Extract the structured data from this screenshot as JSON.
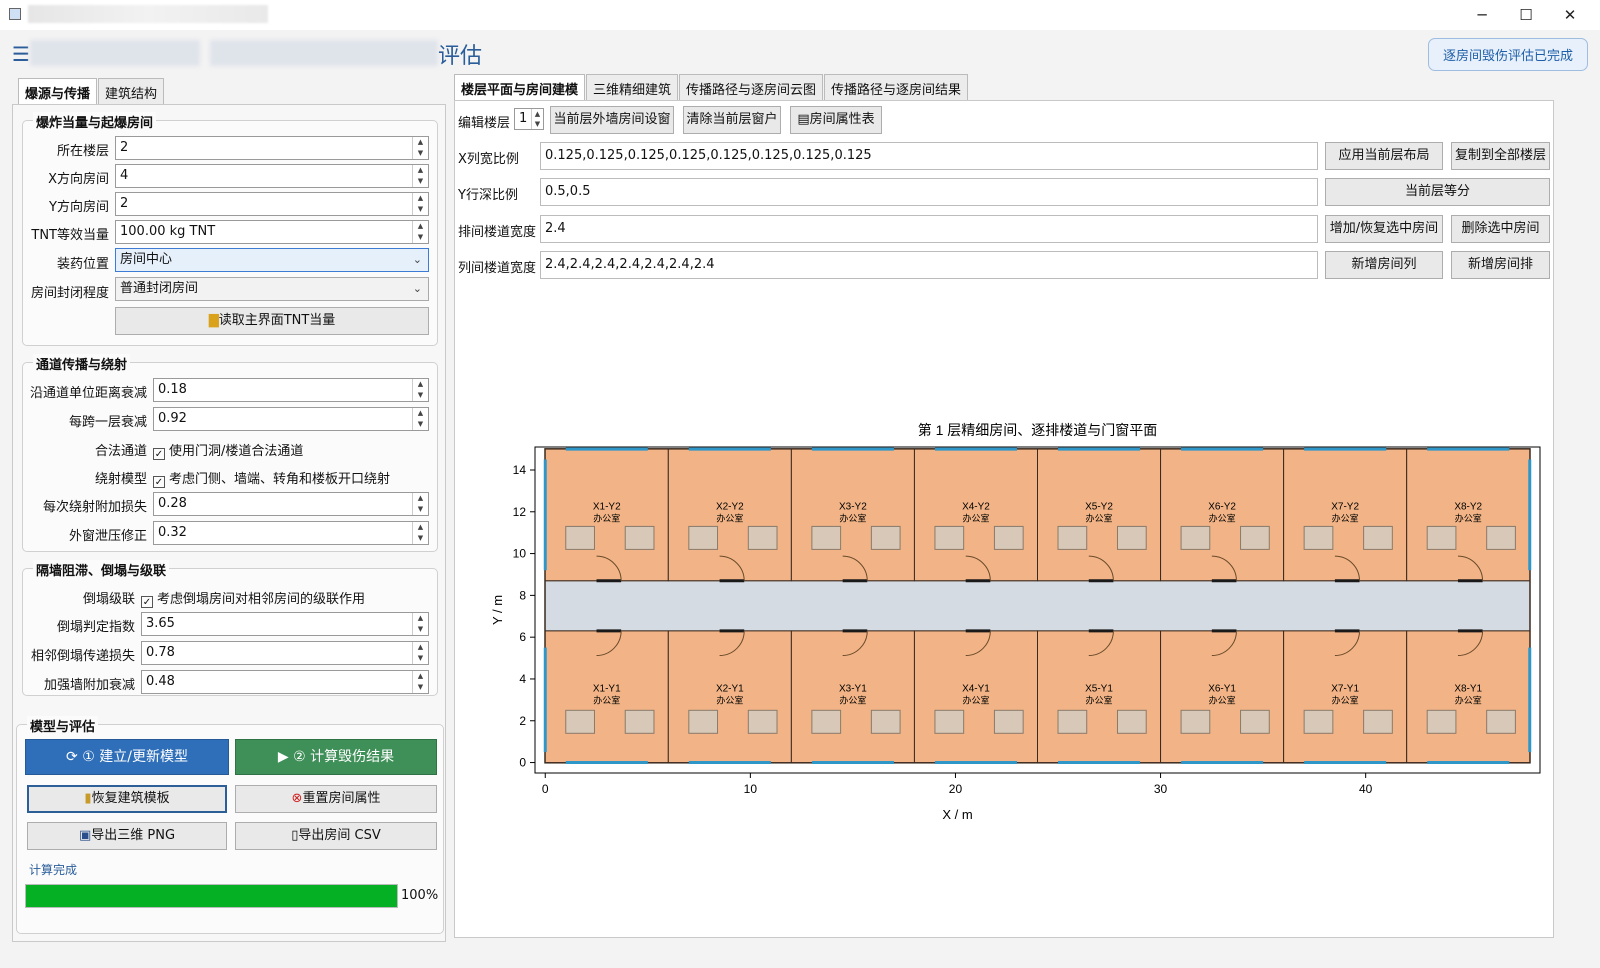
{
  "window": {
    "minimize": "─",
    "maximize": "☐",
    "close": "✕"
  },
  "header": {
    "title_fragment": "评估",
    "status": "逐房间毁伤评估已完成"
  },
  "left_tabs": [
    "爆源与传播",
    "建筑结构"
  ],
  "group1": {
    "title": "爆炸当量与起爆房间",
    "floor_label": "所在楼层",
    "floor_value": "2",
    "xroom_label": "X方向房间",
    "xroom_value": "4",
    "yroom_label": "Y方向房间",
    "yroom_value": "2",
    "tnt_label": "TNT等效当量",
    "tnt_value": "100.00 kg TNT",
    "charge_label": "装药位置",
    "charge_value": "房间中心",
    "seal_label": "房间封闭程度",
    "seal_value": "普通封闭房间",
    "read_button": "读取主界面TNT当量"
  },
  "group2": {
    "title": "通道传播与绕射",
    "atten_label": "沿通道单位距离衰减",
    "atten_value": "0.18",
    "floor_atten_label": "每跨一层衰减",
    "floor_atten_value": "0.92",
    "legal_label": "合法通道",
    "legal_text": "使用门洞/楼道合法通道",
    "diff_label": "绕射模型",
    "diff_text": "考虑门侧、墙端、转角和楼板开口绕射",
    "diff_loss_label": "每次绕射附加损失",
    "diff_loss_value": "0.28",
    "window_label": "外窗泄压修正",
    "window_value": "0.32"
  },
  "group3": {
    "title": "隔墙阻滞、倒塌与级联",
    "cascade_label": "倒塌级联",
    "cascade_text": "考虑倒塌房间对相邻房间的级联作用",
    "collapse_label": "倒塌判定指数",
    "collapse_value": "3.65",
    "adj_label": "相邻倒塌传递损失",
    "adj_value": "0.78",
    "wall_label": "加强墙附加衰减",
    "wall_value": "0.48"
  },
  "group4": {
    "title": "模型与评估",
    "build": "① 建立/更新模型",
    "compute": "② 计算毁伤结果",
    "restore": "恢复建筑模板",
    "reset": "重置房间属性",
    "export_png": "导出三维 PNG",
    "export_csv": "导出房间 CSV",
    "status": "计算完成",
    "progress": 1.0,
    "progress_text": "100%"
  },
  "right_tabs": [
    "楼层平面与房间建模",
    "三维精细建筑",
    "传播路径与逐房间云图",
    "传播路径与逐房间结果"
  ],
  "editor": {
    "floor_label": "编辑楼层",
    "floor_value": "1",
    "btn_exterior": "当前层外墙房间设窗",
    "btn_clear": "清除当前层窗户",
    "btn_props": "房间属性表",
    "x_label": "X列宽比例",
    "x_value": "0.125,0.125,0.125,0.125,0.125,0.125,0.125,0.125",
    "y_label": "Y行深比例",
    "y_value": "0.5,0.5",
    "row_corr_label": "排间楼道宽度",
    "row_corr_value": "2.4",
    "col_corr_label": "列间楼道宽度",
    "col_corr_value": "2.4,2.4,2.4,2.4,2.4,2.4,2.4",
    "apply": "应用当前层布局",
    "copy": "复制到全部楼层",
    "equal": "当前层等分",
    "add_restore": "增加/恢复选中房间",
    "delete": "删除选中房间",
    "add_col": "新增房间列",
    "add_row": "新增房间排"
  },
  "chart_data": {
    "type": "floorplan",
    "title": "第 1 层精细房间、逐排楼道与门窗平面",
    "xlabel": "X / m",
    "ylabel": "Y / m",
    "xlim": [
      -0.5,
      48.5
    ],
    "ylim": [
      -0.5,
      15.1
    ],
    "xticks": [
      0,
      10,
      20,
      30,
      40
    ],
    "yticks": [
      0,
      2,
      4,
      6,
      8,
      10,
      12,
      14
    ],
    "room_width": 6.0,
    "room_depth": 6.3,
    "corridor": [
      6.3,
      8.7
    ],
    "building": [
      0,
      48,
      0,
      15
    ],
    "room_type": "办公室",
    "rooms": [
      {
        "label": "X1-Y2",
        "col": 0,
        "row": 1
      },
      {
        "label": "X2-Y2",
        "col": 1,
        "row": 1
      },
      {
        "label": "X3-Y2",
        "col": 2,
        "row": 1
      },
      {
        "label": "X4-Y2",
        "col": 3,
        "row": 1
      },
      {
        "label": "X5-Y2",
        "col": 4,
        "row": 1
      },
      {
        "label": "X6-Y2",
        "col": 5,
        "row": 1
      },
      {
        "label": "X7-Y2",
        "col": 6,
        "row": 1
      },
      {
        "label": "X8-Y2",
        "col": 7,
        "row": 1
      },
      {
        "label": "X1-Y1",
        "col": 0,
        "row": 0
      },
      {
        "label": "X2-Y1",
        "col": 1,
        "row": 0
      },
      {
        "label": "X3-Y1",
        "col": 2,
        "row": 0
      },
      {
        "label": "X4-Y1",
        "col": 3,
        "row": 0
      },
      {
        "label": "X5-Y1",
        "col": 4,
        "row": 0
      },
      {
        "label": "X6-Y1",
        "col": 5,
        "row": 0
      },
      {
        "label": "X7-Y1",
        "col": 6,
        "row": 0
      },
      {
        "label": "X8-Y1",
        "col": 7,
        "row": 0
      }
    ],
    "colors": {
      "room": "#f2b486",
      "corridor": "#d5dbe2",
      "wall": "#3a2a1f",
      "window": "#2f96c8",
      "furniture": "#d8c8b8",
      "door": "#6a4a2a"
    }
  }
}
